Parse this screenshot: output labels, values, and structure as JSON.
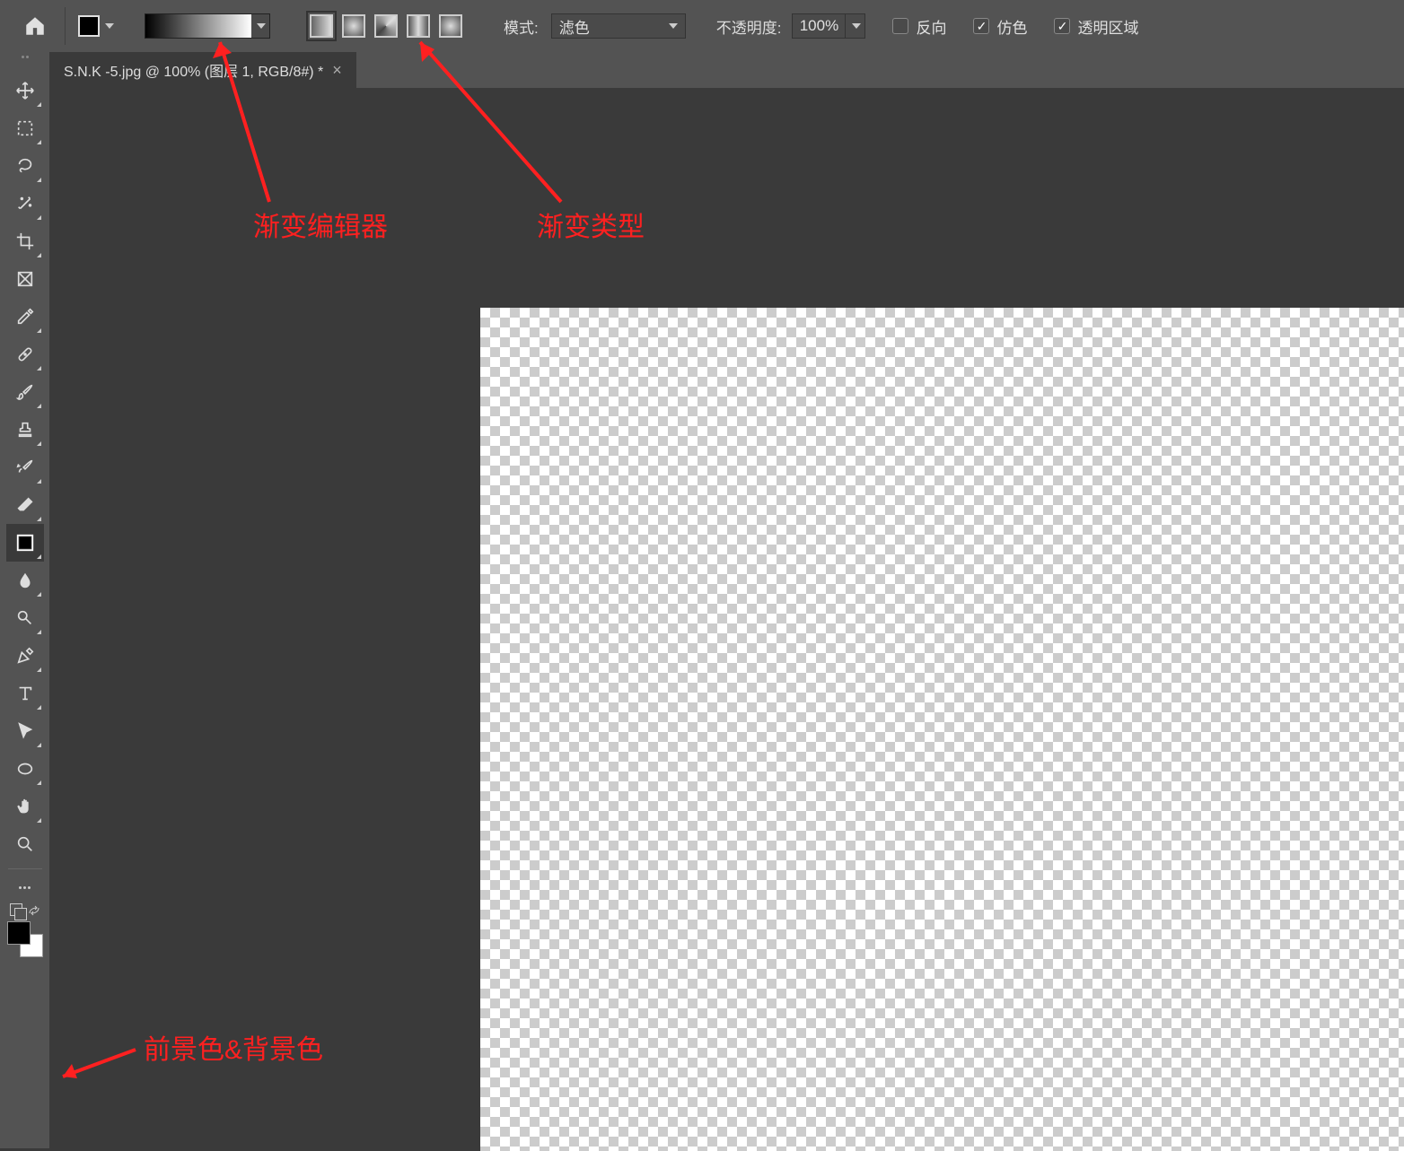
{
  "toolbar": {
    "mode_label": "模式:",
    "mode_value": "滤色",
    "opacity_label": "不透明度:",
    "opacity_value": "100%",
    "reverse_label": "反向",
    "dither_label": "仿色",
    "transparency_label": "透明区域",
    "reverse_checked": false,
    "dither_checked": true,
    "transparency_checked": true
  },
  "document": {
    "tab_title": "S.N.K -5.jpg @ 100% (图层 1, RGB/8#) *"
  },
  "tools": {
    "items": [
      {
        "name": "move-tool"
      },
      {
        "name": "marquee-tool"
      },
      {
        "name": "lasso-tool"
      },
      {
        "name": "quick-select-tool"
      },
      {
        "name": "crop-tool"
      },
      {
        "name": "frame-tool"
      },
      {
        "name": "eyedropper-tool"
      },
      {
        "name": "healing-tool"
      },
      {
        "name": "brush-tool"
      },
      {
        "name": "stamp-tool"
      },
      {
        "name": "history-brush-tool"
      },
      {
        "name": "eraser-tool"
      },
      {
        "name": "gradient-tool"
      },
      {
        "name": "blur-tool"
      },
      {
        "name": "dodge-tool"
      },
      {
        "name": "pen-tool"
      },
      {
        "name": "type-tool"
      },
      {
        "name": "path-select-tool"
      },
      {
        "name": "shape-tool"
      },
      {
        "name": "hand-tool"
      },
      {
        "name": "zoom-tool"
      }
    ]
  },
  "annotations": {
    "gradient_editor": "渐变编辑器",
    "gradient_type": "渐变类型",
    "fgbg": "前景色&背景色"
  },
  "colors": {
    "bg_dark": "#3a3a3a",
    "bg_panel": "#535353",
    "annotation_red": "#ff2020"
  }
}
